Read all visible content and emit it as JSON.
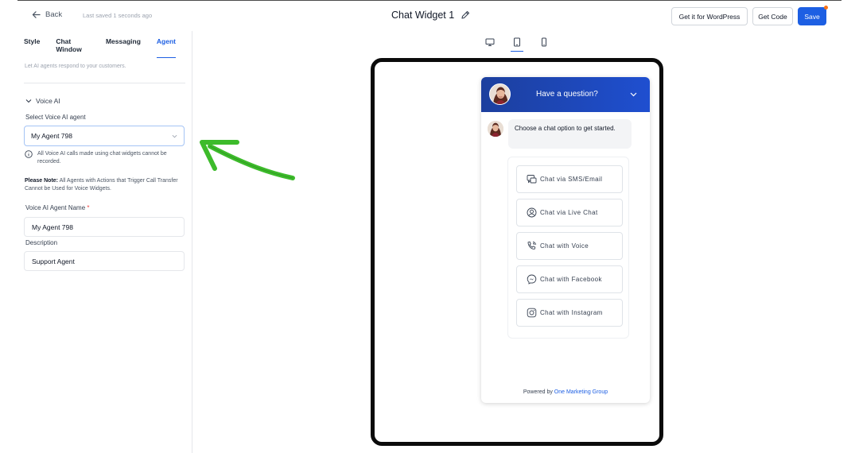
{
  "header": {
    "back_label": "Back",
    "last_saved": "Last saved 1 seconds ago",
    "title": "Chat Widget 1",
    "buttons": {
      "wordpress": "Get it for WordPress",
      "code": "Get Code",
      "save": "Save"
    }
  },
  "sidebar": {
    "tabs": [
      {
        "label": "Style",
        "active": false
      },
      {
        "label": "Chat Window",
        "active": false
      },
      {
        "label": "Messaging",
        "active": false
      },
      {
        "label": "Agent",
        "active": true
      }
    ],
    "subtitle": "Let AI agents respond to your customers.",
    "section_title": "Voice AI",
    "select_label": "Select Voice AI agent",
    "select_value": "My Agent 798",
    "info_text": "All Voice AI calls made using chat widgets cannot be recorded.",
    "note_bold": "Please Note:",
    "note_text": " All Agents with Actions that Trigger Call Transfer Cannot be Used for Voice Widgets.",
    "name_label": "Voice AI Agent Name",
    "name_required": "*",
    "name_value": "My Agent 798",
    "description_label": "Description",
    "description_value": "Support Agent"
  },
  "preview": {
    "devices": [
      {
        "name": "desktop-icon",
        "active": false
      },
      {
        "name": "tablet-icon",
        "active": true
      },
      {
        "name": "mobile-icon",
        "active": false
      }
    ],
    "widget": {
      "header_title": "Have a question?",
      "greeting": "Choose a chat option to get started.",
      "options": [
        {
          "label": "Chat via SMS/Email",
          "icon": "sms-email-icon"
        },
        {
          "label": "Chat via Live Chat",
          "icon": "live-chat-icon"
        },
        {
          "label": "Chat with Voice",
          "icon": "phone-icon"
        },
        {
          "label": "Chat with Facebook",
          "icon": "messenger-icon"
        },
        {
          "label": "Chat with Instagram",
          "icon": "instagram-icon"
        }
      ],
      "powered_by": "Powered by",
      "powered_link": "One Marketing Group"
    }
  },
  "colors": {
    "accent": "#1d5fe3",
    "header_gradient_start": "#1c3f9e",
    "arrow": "#3dbb2b"
  }
}
